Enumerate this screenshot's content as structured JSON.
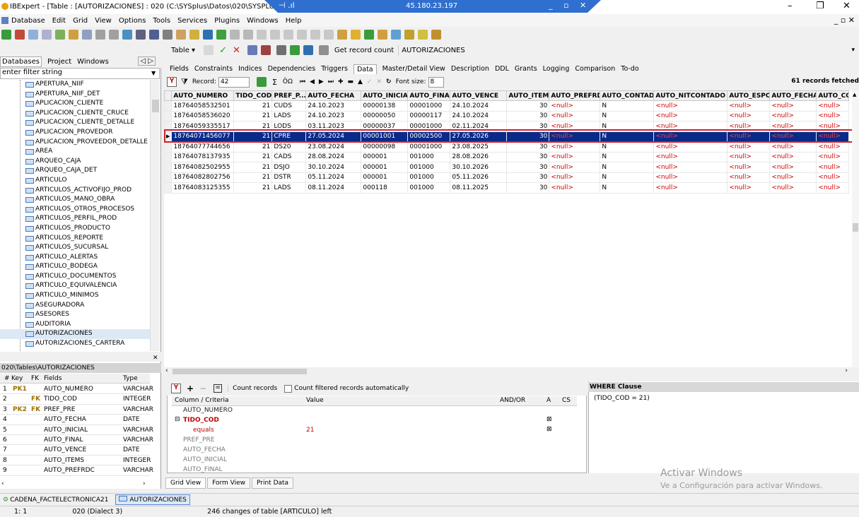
{
  "window": {
    "title": "IBExpert - [Table : [AUTORIZACIONES] : 020 (C:\\SYSplus\\Datos\\020\\SYSPLUS.FDB)]",
    "rdp_ip": "45.180.23.197"
  },
  "menu": [
    "Database",
    "Edit",
    "Grid",
    "View",
    "Options",
    "Tools",
    "Services",
    "Plugins",
    "Windows",
    "Help"
  ],
  "toolbar": {
    "table_label": "Table",
    "get_record_count": "Get record count",
    "table_name": "AUTORIZACIONES"
  },
  "db_panel": {
    "tabs": [
      "Databases",
      "Project",
      "Windows"
    ],
    "filter_placeholder": "enter filter string",
    "tree_items": [
      "APERTURA_NIIF",
      "APERTURA_NIIF_DET",
      "APLICACION_CLIENTE",
      "APLICACION_CLIENTE_CRUCE",
      "APLICACION_CLIENTE_DETALLE",
      "APLICACION_PROVEDOR",
      "APLICACION_PROVEEDOR_DETALLE",
      "AREA",
      "ARQUEO_CAJA",
      "ARQUEO_CAJA_DET",
      "ARTICULO",
      "ARTICULOS_ACTIVOFIJO_PROD",
      "ARTICULOS_MANO_OBRA",
      "ARTICULOS_OTROS_PROCESOS",
      "ARTICULOS_PERFIL_PROD",
      "ARTICULOS_PRODUCTO",
      "ARTICULOS_REPORTE",
      "ARTICULOS_SUCURSAL",
      "ARTICULO_ALERTAS",
      "ARTICULO_BODEGA",
      "ARTICULO_DOCUMENTOS",
      "ARTICULO_EQUIVALENCIA",
      "ARTICULO_MINIMOS",
      "ASEGURADORA",
      "ASESORES",
      "AUDITORIA",
      "AUTORIZACIONES",
      "AUTORIZACIONES_CARTERA"
    ],
    "selected": "AUTORIZACIONES"
  },
  "fields_panel": {
    "path": "020\\Tables\\AUTORIZACIONES",
    "headers": [
      "#",
      "Key",
      "FK",
      "Fields",
      "Type"
    ],
    "rows": [
      {
        "n": "1",
        "key": "PK1",
        "fk": "",
        "name": "AUTO_NUMERO",
        "type": "VARCHAR"
      },
      {
        "n": "2",
        "key": "",
        "fk": "FK",
        "name": "TIDO_COD",
        "type": "INTEGER"
      },
      {
        "n": "3",
        "key": "PK2",
        "fk": "FK",
        "name": "PREF_PRE",
        "type": "VARCHAR"
      },
      {
        "n": "4",
        "key": "",
        "fk": "",
        "name": "AUTO_FECHA",
        "type": "DATE"
      },
      {
        "n": "5",
        "key": "",
        "fk": "",
        "name": "AUTO_INICIAL",
        "type": "VARCHAR"
      },
      {
        "n": "6",
        "key": "",
        "fk": "",
        "name": "AUTO_FINAL",
        "type": "VARCHAR"
      },
      {
        "n": "7",
        "key": "",
        "fk": "",
        "name": "AUTO_VENCE",
        "type": "DATE"
      },
      {
        "n": "8",
        "key": "",
        "fk": "",
        "name": "AUTO_ITEMS",
        "type": "INTEGER"
      },
      {
        "n": "9",
        "key": "",
        "fk": "",
        "name": "AUTO_PREFRDC",
        "type": "VARCHAR"
      }
    ]
  },
  "main_tabs": [
    "Fields",
    "Constraints",
    "Indices",
    "Dependencies",
    "Triggers",
    "Data",
    "Master/Detail View",
    "Description",
    "DDL",
    "Grants",
    "Logging",
    "Comparison",
    "To-do"
  ],
  "active_tab": "Data",
  "nav": {
    "record_label": "Record:",
    "record_value": "42",
    "font_label": "Font size:",
    "font_value": "8",
    "records_fetched": "61 records fetched"
  },
  "grid": {
    "columns": [
      "AUTO_NUMERO",
      "TIDO_COD",
      "PREF_P...",
      "AUTO_FECHA",
      "AUTO_INICIAL",
      "AUTO_FINAL",
      "AUTO_VENCE",
      "AUTO_ITEMS",
      "AUTO_PREFRDC",
      "AUTO_CONTADO",
      "AUTO_NITCONTADO",
      "AUTO_ESPOS",
      "AUTO_FECHAS",
      "AUTO_CC"
    ],
    "rows": [
      [
        "18764058532501",
        "21",
        "CUDS",
        "24.10.2023",
        "00000138",
        "00001000",
        "24.10.2024",
        "30",
        "<null>",
        "N",
        "<null>",
        "<null>",
        "<null>",
        "<null>"
      ],
      [
        "18764058536020",
        "21",
        "LADS",
        "24.10.2023",
        "00000050",
        "00000117",
        "24.10.2024",
        "30",
        "<null>",
        "N",
        "<null>",
        "<null>",
        "<null>",
        "<null>"
      ],
      [
        "18764059335517",
        "21",
        "LODS",
        "03.11.2023",
        "00000037",
        "00001000",
        "02.11.2024",
        "30",
        "<null>",
        "N",
        "<null>",
        "<null>",
        "<null>",
        "<null>"
      ],
      [
        "18764071456077",
        "21",
        "CPRE",
        "27.05.2024",
        "00001001",
        "00002500",
        "27.05.2026",
        "30",
        "<null>",
        "N",
        "<null>",
        "<null>",
        "<null>",
        "<null>"
      ],
      [
        "18764077744656",
        "21",
        "DS20",
        "23.08.2024",
        "00000098",
        "00001000",
        "23.08.2025",
        "30",
        "<null>",
        "N",
        "<null>",
        "<null>",
        "<null>",
        "<null>"
      ],
      [
        "18764078137935",
        "21",
        "CADS",
        "28.08.2024",
        "000001",
        "001000",
        "28.08.2026",
        "30",
        "<null>",
        "N",
        "<null>",
        "<null>",
        "<null>",
        "<null>"
      ],
      [
        "18764082502955",
        "21",
        "DSJO",
        "30.10.2024",
        "000001",
        "001000",
        "30.10.2026",
        "30",
        "<null>",
        "N",
        "<null>",
        "<null>",
        "<null>",
        "<null>"
      ],
      [
        "18764082802756",
        "21",
        "DSTR",
        "05.11.2024",
        "000001",
        "001000",
        "05.11.2026",
        "30",
        "<null>",
        "N",
        "<null>",
        "<null>",
        "<null>",
        "<null>"
      ],
      [
        "18764083125355",
        "21",
        "LADS",
        "08.11.2024",
        "000118",
        "001000",
        "08.11.2025",
        "30",
        "<null>",
        "N",
        "<null>",
        "<null>",
        "<null>",
        "<null>"
      ]
    ],
    "selected_row": 3
  },
  "filter": {
    "count_records": "Count records",
    "count_filtered": "Count filtered records automatically",
    "headers": [
      "Column / Criteria",
      "Value",
      "AND/OR",
      "A",
      "CS"
    ],
    "items": [
      "AUTO_NUMERO",
      "TIDO_COD",
      "equals",
      "PREF_PRE",
      "AUTO_FECHA",
      "AUTO_INICIAL",
      "AUTO_FINAL"
    ],
    "equals_value": "21",
    "where_title": "WHERE Clause",
    "where_text": "(TIDO_COD = 21)"
  },
  "bottom_tabs": [
    "Grid View",
    "Form View",
    "Print Data"
  ],
  "window_tabs": [
    "CADENA_FACTELECTRONICA21",
    "AUTORIZACIONES"
  ],
  "status": {
    "pos": "1:  1",
    "dialect": "020 (Dialect 3)",
    "message": "246 changes of table [ARTICULO] left"
  },
  "activate": {
    "title": "Activar Windows",
    "subtitle": "Ve a Configuración para activar Windows."
  }
}
